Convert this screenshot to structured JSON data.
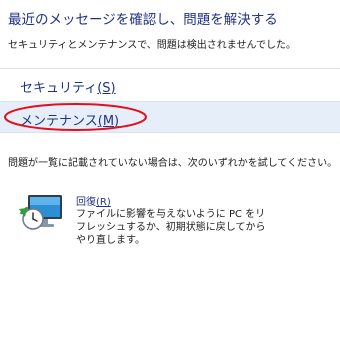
{
  "header": {
    "title": "最近のメッセージを確認し、問題を解決する",
    "subtitle": "セキュリティとメンテナンスで、問題は検出されませんでした。"
  },
  "sections": {
    "security": {
      "label": "セキュリティ",
      "accesskey": "(S)"
    },
    "maintenance": {
      "label": "メンテナンス",
      "accesskey": "(M)"
    }
  },
  "note": "問題が一覧に記載されていない場合は、次のいずれかを試してください。",
  "recovery": {
    "label": "回復",
    "accesskey": "(R)",
    "description": "ファイルに影響を与えないように PC をリフレッシュするか、初期状態に戻してからやり直します。",
    "icon": "recovery-icon"
  },
  "colors": {
    "link": "#1e3287",
    "section_highlight": "#e6eef9",
    "annotation": "#e0101c"
  }
}
